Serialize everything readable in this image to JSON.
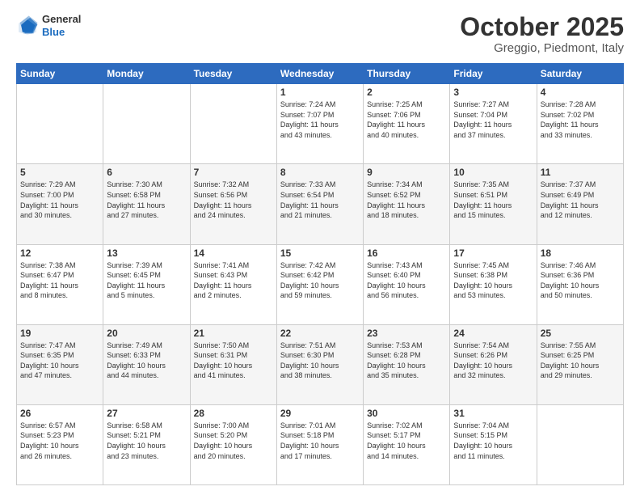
{
  "header": {
    "logo_general": "General",
    "logo_blue": "Blue",
    "month": "October 2025",
    "location": "Greggio, Piedmont, Italy"
  },
  "days_of_week": [
    "Sunday",
    "Monday",
    "Tuesday",
    "Wednesday",
    "Thursday",
    "Friday",
    "Saturday"
  ],
  "weeks": [
    [
      {
        "num": "",
        "info": ""
      },
      {
        "num": "",
        "info": ""
      },
      {
        "num": "",
        "info": ""
      },
      {
        "num": "1",
        "info": "Sunrise: 7:24 AM\nSunset: 7:07 PM\nDaylight: 11 hours\nand 43 minutes."
      },
      {
        "num": "2",
        "info": "Sunrise: 7:25 AM\nSunset: 7:06 PM\nDaylight: 11 hours\nand 40 minutes."
      },
      {
        "num": "3",
        "info": "Sunrise: 7:27 AM\nSunset: 7:04 PM\nDaylight: 11 hours\nand 37 minutes."
      },
      {
        "num": "4",
        "info": "Sunrise: 7:28 AM\nSunset: 7:02 PM\nDaylight: 11 hours\nand 33 minutes."
      }
    ],
    [
      {
        "num": "5",
        "info": "Sunrise: 7:29 AM\nSunset: 7:00 PM\nDaylight: 11 hours\nand 30 minutes."
      },
      {
        "num": "6",
        "info": "Sunrise: 7:30 AM\nSunset: 6:58 PM\nDaylight: 11 hours\nand 27 minutes."
      },
      {
        "num": "7",
        "info": "Sunrise: 7:32 AM\nSunset: 6:56 PM\nDaylight: 11 hours\nand 24 minutes."
      },
      {
        "num": "8",
        "info": "Sunrise: 7:33 AM\nSunset: 6:54 PM\nDaylight: 11 hours\nand 21 minutes."
      },
      {
        "num": "9",
        "info": "Sunrise: 7:34 AM\nSunset: 6:52 PM\nDaylight: 11 hours\nand 18 minutes."
      },
      {
        "num": "10",
        "info": "Sunrise: 7:35 AM\nSunset: 6:51 PM\nDaylight: 11 hours\nand 15 minutes."
      },
      {
        "num": "11",
        "info": "Sunrise: 7:37 AM\nSunset: 6:49 PM\nDaylight: 11 hours\nand 12 minutes."
      }
    ],
    [
      {
        "num": "12",
        "info": "Sunrise: 7:38 AM\nSunset: 6:47 PM\nDaylight: 11 hours\nand 8 minutes."
      },
      {
        "num": "13",
        "info": "Sunrise: 7:39 AM\nSunset: 6:45 PM\nDaylight: 11 hours\nand 5 minutes."
      },
      {
        "num": "14",
        "info": "Sunrise: 7:41 AM\nSunset: 6:43 PM\nDaylight: 11 hours\nand 2 minutes."
      },
      {
        "num": "15",
        "info": "Sunrise: 7:42 AM\nSunset: 6:42 PM\nDaylight: 10 hours\nand 59 minutes."
      },
      {
        "num": "16",
        "info": "Sunrise: 7:43 AM\nSunset: 6:40 PM\nDaylight: 10 hours\nand 56 minutes."
      },
      {
        "num": "17",
        "info": "Sunrise: 7:45 AM\nSunset: 6:38 PM\nDaylight: 10 hours\nand 53 minutes."
      },
      {
        "num": "18",
        "info": "Sunrise: 7:46 AM\nSunset: 6:36 PM\nDaylight: 10 hours\nand 50 minutes."
      }
    ],
    [
      {
        "num": "19",
        "info": "Sunrise: 7:47 AM\nSunset: 6:35 PM\nDaylight: 10 hours\nand 47 minutes."
      },
      {
        "num": "20",
        "info": "Sunrise: 7:49 AM\nSunset: 6:33 PM\nDaylight: 10 hours\nand 44 minutes."
      },
      {
        "num": "21",
        "info": "Sunrise: 7:50 AM\nSunset: 6:31 PM\nDaylight: 10 hours\nand 41 minutes."
      },
      {
        "num": "22",
        "info": "Sunrise: 7:51 AM\nSunset: 6:30 PM\nDaylight: 10 hours\nand 38 minutes."
      },
      {
        "num": "23",
        "info": "Sunrise: 7:53 AM\nSunset: 6:28 PM\nDaylight: 10 hours\nand 35 minutes."
      },
      {
        "num": "24",
        "info": "Sunrise: 7:54 AM\nSunset: 6:26 PM\nDaylight: 10 hours\nand 32 minutes."
      },
      {
        "num": "25",
        "info": "Sunrise: 7:55 AM\nSunset: 6:25 PM\nDaylight: 10 hours\nand 29 minutes."
      }
    ],
    [
      {
        "num": "26",
        "info": "Sunrise: 6:57 AM\nSunset: 5:23 PM\nDaylight: 10 hours\nand 26 minutes."
      },
      {
        "num": "27",
        "info": "Sunrise: 6:58 AM\nSunset: 5:21 PM\nDaylight: 10 hours\nand 23 minutes."
      },
      {
        "num": "28",
        "info": "Sunrise: 7:00 AM\nSunset: 5:20 PM\nDaylight: 10 hours\nand 20 minutes."
      },
      {
        "num": "29",
        "info": "Sunrise: 7:01 AM\nSunset: 5:18 PM\nDaylight: 10 hours\nand 17 minutes."
      },
      {
        "num": "30",
        "info": "Sunrise: 7:02 AM\nSunset: 5:17 PM\nDaylight: 10 hours\nand 14 minutes."
      },
      {
        "num": "31",
        "info": "Sunrise: 7:04 AM\nSunset: 5:15 PM\nDaylight: 10 hours\nand 11 minutes."
      },
      {
        "num": "",
        "info": ""
      }
    ]
  ]
}
